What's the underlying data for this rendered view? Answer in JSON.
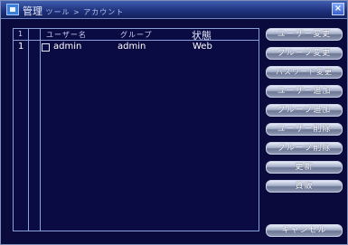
{
  "window": {
    "title": "管理",
    "breadcrumb": "ツール > アカウント",
    "close_label": "×"
  },
  "table": {
    "headers": {
      "index": "1",
      "name": "ユーザー名",
      "group": "グループ",
      "state": "状態"
    },
    "rows": [
      {
        "index": "1",
        "name": "admin",
        "group": "admin",
        "state": "Web"
      }
    ]
  },
  "buttons": {
    "modify_user": "ユーザー変更",
    "modify_group": "グループ変更",
    "modify_password": "パスワード変更",
    "add_user": "ユーザー追加",
    "add_group": "グループ追加",
    "delete_user": "ユーザー削除",
    "delete_group": "グループ削除",
    "update": "更新",
    "assign": "資販",
    "cancel": "キャンセル"
  }
}
